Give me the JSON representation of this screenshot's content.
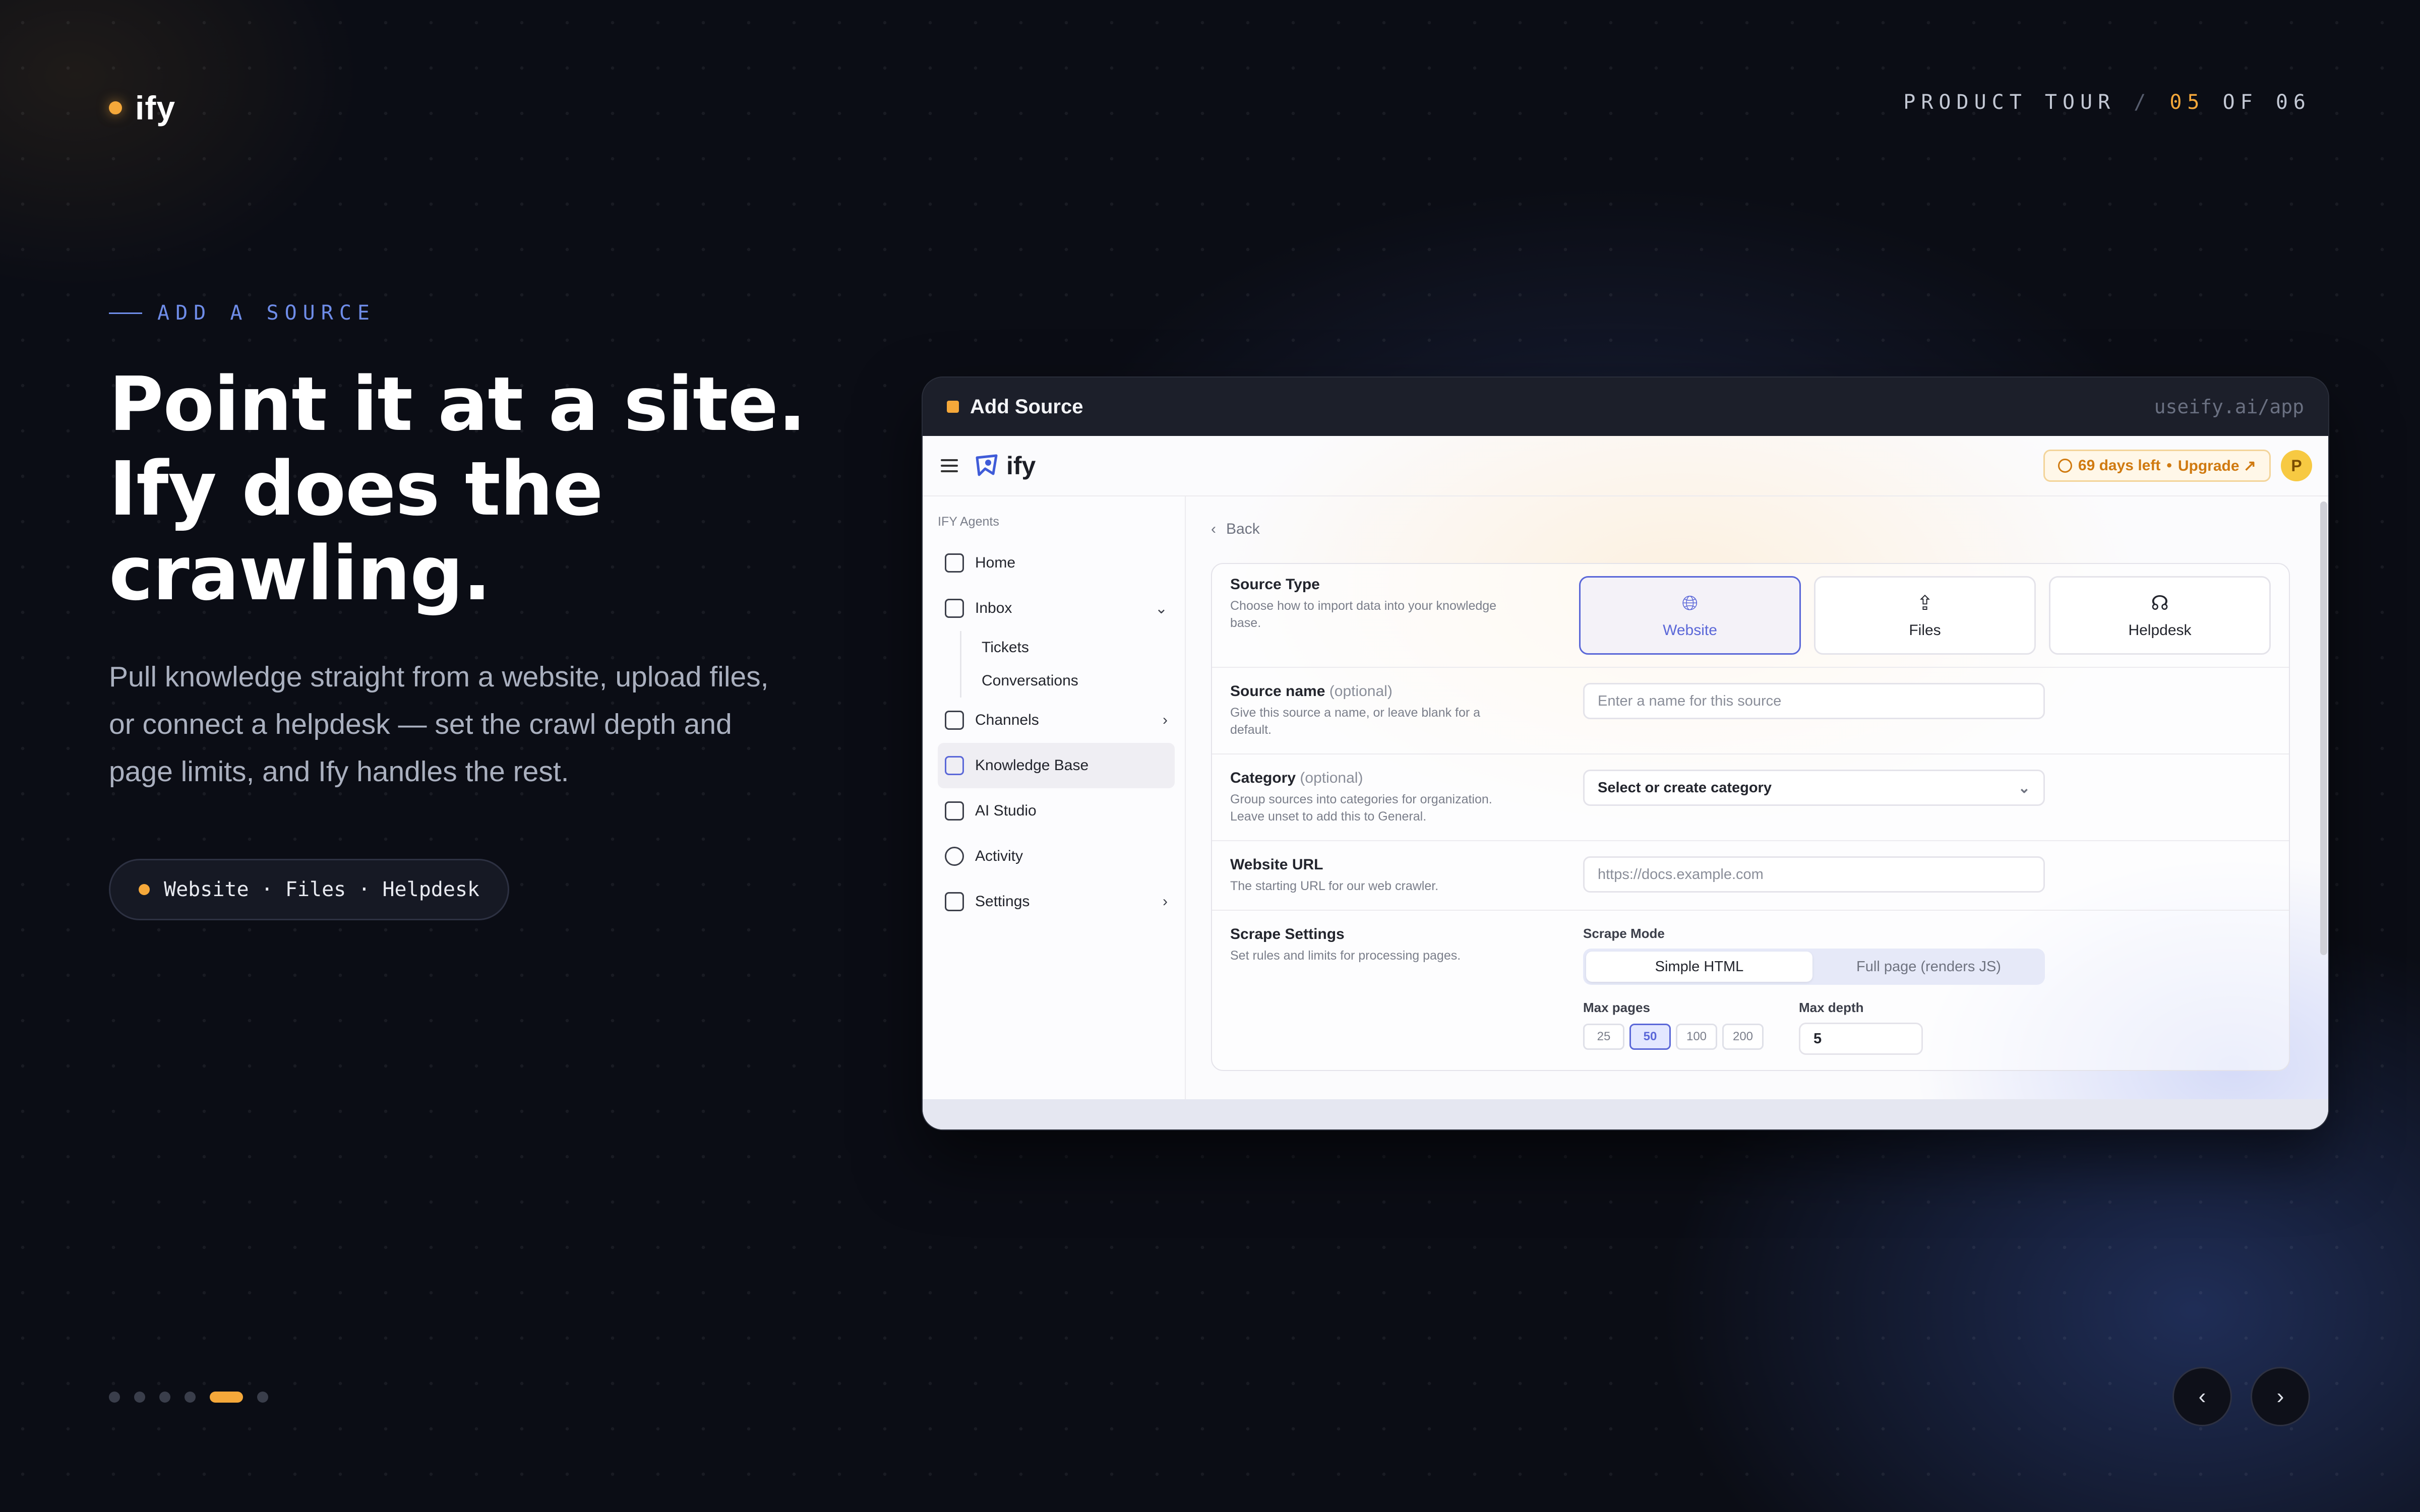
{
  "brand": {
    "name": "ify"
  },
  "tour": {
    "label": "PRODUCT TOUR",
    "separator": "/",
    "current": "05",
    "of": "OF 06"
  },
  "hero": {
    "eyebrow": "ADD A SOURCE",
    "headline_1": "Point it at a site.",
    "headline_2": "Ify does the",
    "headline_3": "crawling.",
    "subtext": "Pull knowledge straight from a website, upload files, or connect a helpdesk — set the crawl depth and page limits, and Ify handles the rest.",
    "pill": "Website · Files · Helpdesk"
  },
  "pager": {
    "total": 6,
    "active": 5
  },
  "nav": {
    "prev": "‹",
    "next": "›"
  },
  "colors": {
    "accent": "#f5a83a",
    "blue": "#6f8de9",
    "selected": "#5a67d8"
  },
  "window": {
    "title": "Add Source",
    "url": "useify.ai/app",
    "app": {
      "logo": "ify",
      "trial_days": "69 days left",
      "trial_sep": "•",
      "upgrade": "Upgrade ↗",
      "avatar": "P",
      "sidebar": {
        "section": "IFY Agents",
        "items": [
          {
            "label": "Home",
            "icon": "home-icon"
          },
          {
            "label": "Inbox",
            "icon": "inbox-icon",
            "chevron": "⌄"
          },
          {
            "label": "Tickets"
          },
          {
            "label": "Conversations"
          },
          {
            "label": "Channels",
            "icon": "layers-icon",
            "chevron": "›"
          },
          {
            "label": "Knowledge Base",
            "icon": "book-icon"
          },
          {
            "label": "AI Studio",
            "icon": "bot-icon"
          },
          {
            "label": "Activity",
            "icon": "eye-icon"
          },
          {
            "label": "Settings",
            "icon": "sliders-icon",
            "chevron": "›"
          }
        ]
      },
      "back": "Back",
      "form": {
        "source_type": {
          "title": "Source Type",
          "desc": "Choose how to import data into your knowledge base.",
          "options": [
            {
              "label": "Website",
              "icon": "globe-icon",
              "glyph": "🌐︎"
            },
            {
              "label": "Files",
              "icon": "upload-icon",
              "glyph": "⇪"
            },
            {
              "label": "Helpdesk",
              "icon": "headphones-icon",
              "glyph": "☊"
            }
          ],
          "selected": "Website"
        },
        "source_name": {
          "title": "Source name",
          "optional": "(optional)",
          "desc": "Give this source a name, or leave blank for a default.",
          "placeholder": "Enter a name for this source"
        },
        "category": {
          "title": "Category",
          "optional": "(optional)",
          "desc": "Group sources into categories for organization. Leave unset to add this to General.",
          "value": "Select or create category",
          "dd": "⌄"
        },
        "website_url": {
          "title": "Website URL",
          "desc": "The starting URL for our web crawler.",
          "placeholder": "https://docs.example.com"
        },
        "scrape": {
          "title": "Scrape Settings",
          "desc": "Set rules and limits for processing pages.",
          "mode_label": "Scrape Mode",
          "modes": [
            "Simple HTML",
            "Full page (renders JS)"
          ],
          "mode_selected": "Simple HTML",
          "max_pages_label": "Max pages",
          "max_pages": [
            "25",
            "50",
            "100",
            "200"
          ],
          "max_pages_selected": "50",
          "max_depth_label": "Max depth",
          "max_depth": "5"
        }
      }
    }
  }
}
